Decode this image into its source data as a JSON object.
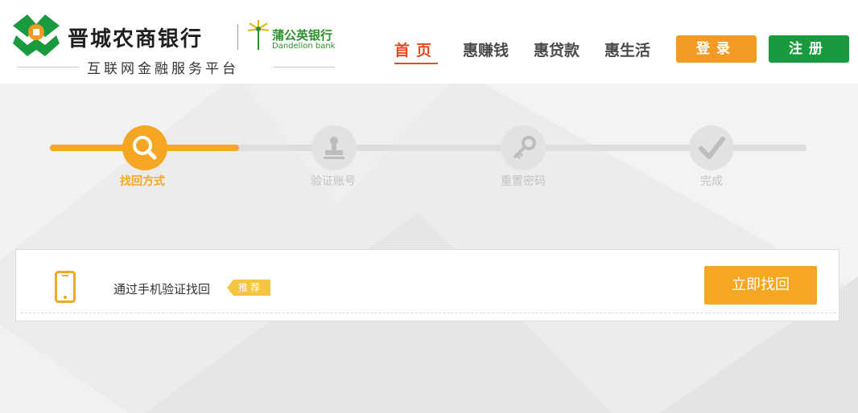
{
  "header": {
    "bank_name": "晋城农商银行",
    "partner_name_cn": "蒲公英银行",
    "partner_name_en": "Dandelion bank",
    "slogan": "互联网金融服务平台",
    "nav": [
      {
        "label": "首页",
        "active": true
      },
      {
        "label": "惠赚钱",
        "active": false
      },
      {
        "label": "惠贷款",
        "active": false
      },
      {
        "label": "惠生活",
        "active": false
      }
    ],
    "login_label": "登录",
    "register_label": "注册"
  },
  "steps": [
    {
      "label": "找回方式",
      "icon": "search-icon",
      "active": true
    },
    {
      "label": "验证账号",
      "icon": "stamp-icon",
      "active": false
    },
    {
      "label": "重置密码",
      "icon": "key-icon",
      "active": false
    },
    {
      "label": "完成",
      "icon": "checkmark-icon",
      "active": false
    }
  ],
  "step_progress_fraction": 0.25,
  "option": {
    "icon": "phone-icon",
    "text": "通过手机验证找回",
    "badge": "推荐",
    "button_label": "立即找回"
  },
  "colors": {
    "accent_orange": "#f5a623",
    "brand_green": "#1a9a3e",
    "nav_active": "#e84a1e"
  }
}
